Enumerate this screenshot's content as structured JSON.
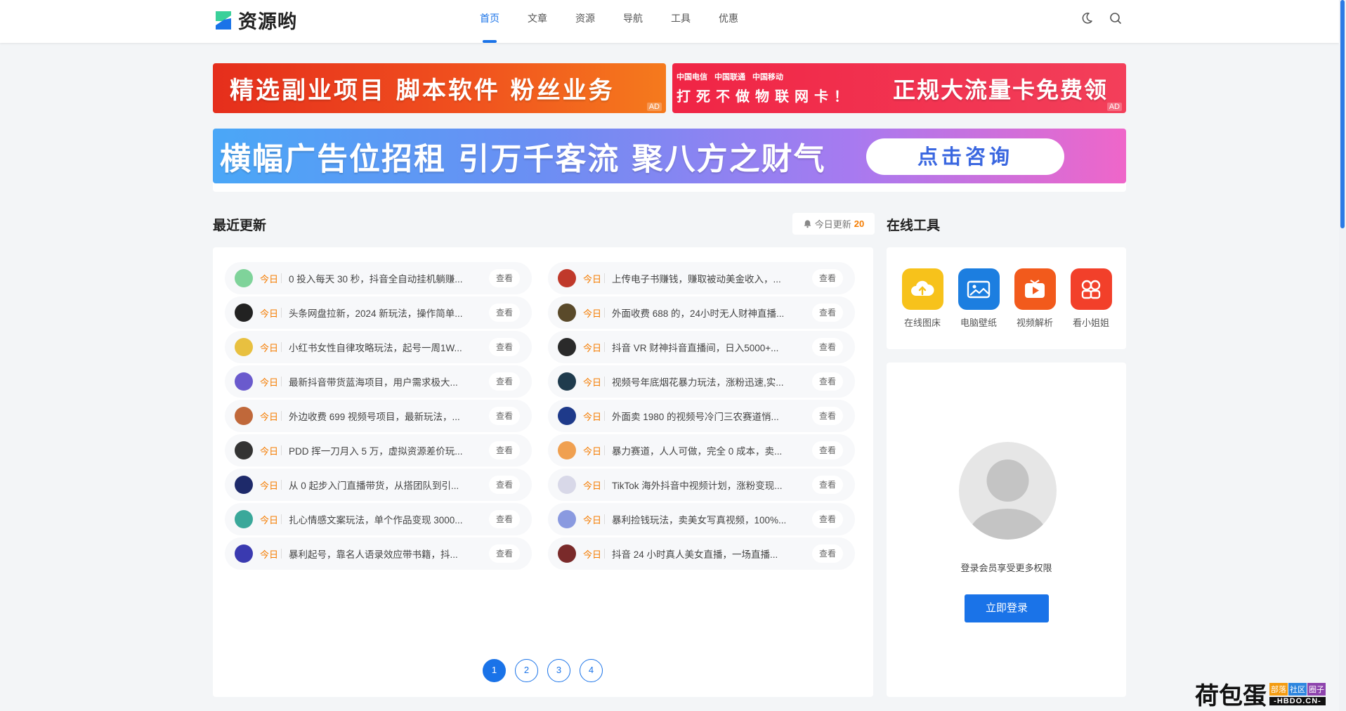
{
  "brand": {
    "name": "资源哟"
  },
  "nav": {
    "items": [
      {
        "label": "首页",
        "active": true
      },
      {
        "label": "文章"
      },
      {
        "label": "资源"
      },
      {
        "label": "导航"
      },
      {
        "label": "工具"
      },
      {
        "label": "优惠"
      }
    ]
  },
  "header_icons": [
    "moon-icon",
    "search-icon"
  ],
  "banners": {
    "b1": {
      "text": "精选副业项目 脚本软件 粉丝业务",
      "ad": "AD"
    },
    "b2": {
      "carriers": [
        "中国电信",
        "中国联通",
        "中国移动"
      ],
      "slogan": "打死不做物联网卡！",
      "text": "正规大流量卡免费领",
      "ad": "AD"
    },
    "b3": {
      "text": "横幅广告位招租 引万千客流 聚八方之财气",
      "button": "点击咨询"
    }
  },
  "recent": {
    "title": "最近更新",
    "today_label": "今日更新",
    "today_count": "20",
    "tag": "今日",
    "view_label": "查看",
    "items": [
      {
        "title": "0 投入每天 30 秒，抖音全自动挂机躺赚...",
        "color": "#7fd39a"
      },
      {
        "title": "上传电子书赚钱，赚取被动美金收入，...",
        "color": "#c0392b"
      },
      {
        "title": "头条网盘拉新，2024 新玩法，操作简单...",
        "color": "#222222"
      },
      {
        "title": "外面收费 688 的，24小时无人财神直播...",
        "color": "#5a4a2a"
      },
      {
        "title": "小红书女性自律攻略玩法，起号一周1W...",
        "color": "#e8c040"
      },
      {
        "title": "抖音 VR 财神抖音直播间，日入5000+...",
        "color": "#2a2a2a"
      },
      {
        "title": "最新抖音带货蓝海项目，用户需求极大...",
        "color": "#6a5acd"
      },
      {
        "title": "视频号年底烟花暴力玩法，涨粉迅速,实...",
        "color": "#1f3b4d"
      },
      {
        "title": "外边收费 699 视频号项目，最新玩法，...",
        "color": "#c0683a"
      },
      {
        "title": "外面卖 1980 的视频号冷门三农赛道悄...",
        "color": "#1e3a8a"
      },
      {
        "title": "PDD 挥一刀月入 5 万，虚拟资源差价玩...",
        "color": "#333333"
      },
      {
        "title": "暴力赛道，人人可做，完全 0 成本，卖...",
        "color": "#f0a050"
      },
      {
        "title": "从 0 起步入门直播带货，从搭团队到引...",
        "color": "#1e2a6a"
      },
      {
        "title": "TikTok 海外抖音中视频计划，涨粉变现...",
        "color": "#d8d8e8"
      },
      {
        "title": "扎心情感文案玩法，单个作品变现 3000...",
        "color": "#3aa89a"
      },
      {
        "title": "暴利捡钱玩法，卖美女写真视频，100%...",
        "color": "#8a9ae0"
      },
      {
        "title": "暴利起号，靠名人语录效应带书籍，抖...",
        "color": "#3a3ab0"
      },
      {
        "title": "抖音 24 小时真人美女直播，一场直播...",
        "color": "#7a2a2a"
      }
    ],
    "pages": [
      "1",
      "2",
      "3",
      "4"
    ],
    "current_page": "1"
  },
  "tools": {
    "title": "在线工具",
    "items": [
      {
        "label": "在线图床",
        "icon": "cloud-upload-icon",
        "color": "#f7c21b"
      },
      {
        "label": "电脑壁纸",
        "icon": "image-icon",
        "color": "#1c7ee0"
      },
      {
        "label": "视频解析",
        "icon": "tv-play-icon",
        "color": "#f25a1c"
      },
      {
        "label": "看小姐姐",
        "icon": "grid-apps-icon",
        "color": "#f2402a"
      }
    ]
  },
  "login": {
    "desc": "登录会员享受更多权限",
    "button": "立即登录"
  },
  "watermark": {
    "main": "荷包蛋",
    "tags": [
      "部落",
      "社区",
      "圈子"
    ],
    "url": "-HBDO.CN-"
  }
}
